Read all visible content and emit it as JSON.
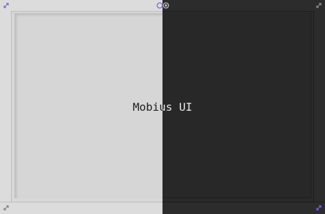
{
  "app": {
    "title": "Mobius UI"
  },
  "colors": {
    "light_bg": "#d8d8d8",
    "dark_bg": "#2a2a2a",
    "accent": "#8a5cf6",
    "light_text": "#1e1e1e",
    "dark_text": "#e8e8e8"
  },
  "icons": {
    "top_left": "resize-icon",
    "top_center_left": "theme-ring-icon",
    "top_center_right": "theme-dot-icon",
    "top_right": "resize-icon",
    "bottom_left": "resize-icon",
    "bottom_right": "resize-icon"
  }
}
